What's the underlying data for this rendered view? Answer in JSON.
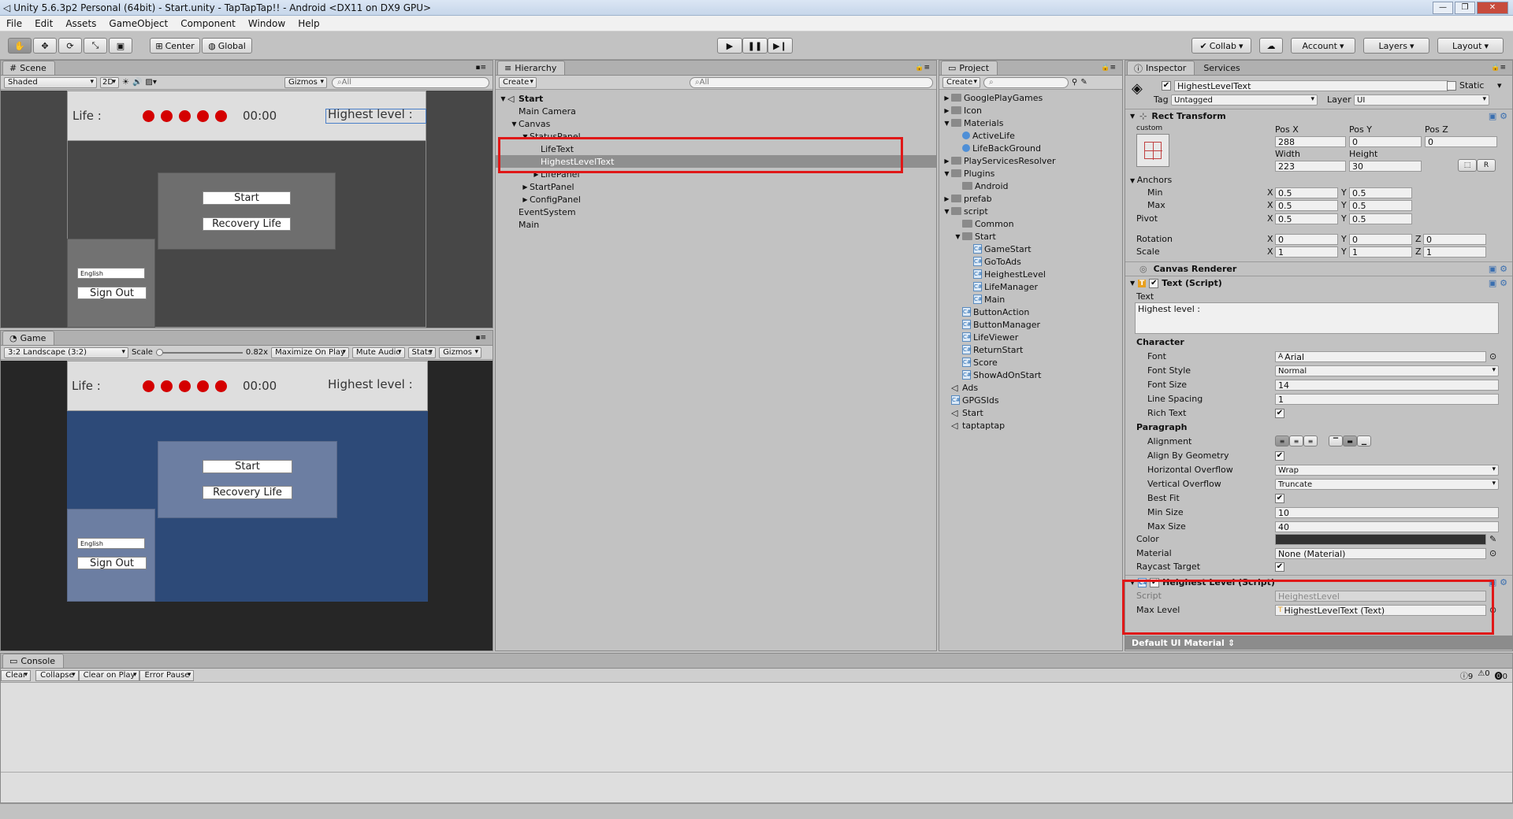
{
  "window": {
    "title": "Unity 5.6.3p2 Personal (64bit) - Start.unity - TapTapTap!! - Android <DX11 on DX9 GPU>"
  },
  "menu": [
    "File",
    "Edit",
    "Assets",
    "GameObject",
    "Component",
    "Window",
    "Help"
  ],
  "toolbar": {
    "center": "Center",
    "global": "Global",
    "collab": "Collab",
    "account": "Account",
    "layers": "Layers",
    "layout": "Layout"
  },
  "scene": {
    "tab": "Scene",
    "shaded": "Shaded",
    "mode2d": "2D",
    "gizmos": "Gizmos",
    "search": "All"
  },
  "game": {
    "tab": "Game",
    "aspect": "3:2 Landscape (3:2)",
    "scale_label": "Scale",
    "scale_value": "0.82x",
    "maximize": "Maximize On Play",
    "mute": "Mute Audio",
    "stats": "Stats",
    "gizmos": "Gizmos"
  },
  "ui": {
    "life": "Life :",
    "time": "00:00",
    "highest": "Highest level :",
    "start": "Start",
    "recovery": "Recovery Life",
    "language": "English",
    "signout": "Sign Out"
  },
  "hierarchy": {
    "tab": "Hierarchy",
    "create": "Create",
    "search": "All",
    "rows": [
      {
        "label": "Start",
        "indent": 0,
        "arrow": "▼",
        "bold": true
      },
      {
        "label": "Main Camera",
        "indent": 1,
        "arrow": ""
      },
      {
        "label": "Canvas",
        "indent": 1,
        "arrow": "▼"
      },
      {
        "label": "StatusPanel",
        "indent": 2,
        "arrow": "▼"
      },
      {
        "label": "LifeText",
        "indent": 3,
        "arrow": ""
      },
      {
        "label": "HighestLevelText",
        "indent": 3,
        "arrow": "",
        "selected": true
      },
      {
        "label": "LifePanel",
        "indent": 3,
        "arrow": "▶"
      },
      {
        "label": "StartPanel",
        "indent": 2,
        "arrow": "▶"
      },
      {
        "label": "ConfigPanel",
        "indent": 2,
        "arrow": "▶"
      },
      {
        "label": "EventSystem",
        "indent": 1,
        "arrow": ""
      },
      {
        "label": "Main",
        "indent": 1,
        "arrow": ""
      }
    ]
  },
  "project": {
    "tab": "Project",
    "create": "Create",
    "rows": [
      {
        "label": "GooglePlayGames",
        "indent": 0,
        "arrow": "▶",
        "icon": "folder"
      },
      {
        "label": "Icon",
        "indent": 0,
        "arrow": "▶",
        "icon": "folder"
      },
      {
        "label": "Materials",
        "indent": 0,
        "arrow": "▼",
        "icon": "folder"
      },
      {
        "label": "ActiveLife",
        "indent": 1,
        "arrow": "",
        "icon": "circle"
      },
      {
        "label": "LifeBackGround",
        "indent": 1,
        "arrow": "",
        "icon": "circle"
      },
      {
        "label": "PlayServicesResolver",
        "indent": 0,
        "arrow": "▶",
        "icon": "folder"
      },
      {
        "label": "Plugins",
        "indent": 0,
        "arrow": "▼",
        "icon": "folder"
      },
      {
        "label": "Android",
        "indent": 1,
        "arrow": "",
        "icon": "folder"
      },
      {
        "label": "prefab",
        "indent": 0,
        "arrow": "▶",
        "icon": "folder"
      },
      {
        "label": "script",
        "indent": 0,
        "arrow": "▼",
        "icon": "folder"
      },
      {
        "label": "Common",
        "indent": 1,
        "arrow": "",
        "icon": "folder"
      },
      {
        "label": "Start",
        "indent": 1,
        "arrow": "▼",
        "icon": "folder"
      },
      {
        "label": "GameStart",
        "indent": 2,
        "arrow": "",
        "icon": "script"
      },
      {
        "label": "GoToAds",
        "indent": 2,
        "arrow": "",
        "icon": "script"
      },
      {
        "label": "HeighestLevel",
        "indent": 2,
        "arrow": "",
        "icon": "script"
      },
      {
        "label": "LifeManager",
        "indent": 2,
        "arrow": "",
        "icon": "script"
      },
      {
        "label": "Main",
        "indent": 2,
        "arrow": "",
        "icon": "script"
      },
      {
        "label": "ButtonAction",
        "indent": 1,
        "arrow": "",
        "icon": "script"
      },
      {
        "label": "ButtonManager",
        "indent": 1,
        "arrow": "",
        "icon": "script"
      },
      {
        "label": "LifeViewer",
        "indent": 1,
        "arrow": "",
        "icon": "script"
      },
      {
        "label": "ReturnStart",
        "indent": 1,
        "arrow": "",
        "icon": "script"
      },
      {
        "label": "Score",
        "indent": 1,
        "arrow": "",
        "icon": "script"
      },
      {
        "label": "ShowAdOnStart",
        "indent": 1,
        "arrow": "",
        "icon": "script"
      },
      {
        "label": "Ads",
        "indent": 0,
        "arrow": "",
        "icon": "unity"
      },
      {
        "label": "GPGSIds",
        "indent": 0,
        "arrow": "",
        "icon": "script"
      },
      {
        "label": "Start",
        "indent": 0,
        "arrow": "",
        "icon": "unity"
      },
      {
        "label": "taptaptap",
        "indent": 0,
        "arrow": "",
        "icon": "unity"
      }
    ]
  },
  "inspector": {
    "tab": "Inspector",
    "services": "Services",
    "object_name": "HighestLevelText",
    "static": "Static",
    "tag_label": "Tag",
    "tag": "Untagged",
    "layer_label": "Layer",
    "layer": "UI",
    "rect": {
      "title": "Rect Transform",
      "custom": "custom",
      "posx_l": "Pos X",
      "posy_l": "Pos Y",
      "posz_l": "Pos Z",
      "posx": "288",
      "posy": "0",
      "posz": "0",
      "width_l": "Width",
      "height_l": "Height",
      "width": "223",
      "height": "30",
      "r": "R",
      "anchors": "Anchors",
      "min": "Min",
      "max": "Max",
      "pivot": "Pivot",
      "rotation": "Rotation",
      "scale": "Scale",
      "x": "X",
      "y": "Y",
      "z": "Z",
      "min_x": "0.5",
      "min_y": "0.5",
      "max_x": "0.5",
      "max_y": "0.5",
      "pivot_x": "0.5",
      "pivot_y": "0.5",
      "rot_x": "0",
      "rot_y": "0",
      "rot_z": "0",
      "scale_x": "1",
      "scale_y": "1",
      "scale_z": "1"
    },
    "canvas_renderer": "Canvas Renderer",
    "text": {
      "title": "Text (Script)",
      "text_label": "Text",
      "text_value": "Highest level :",
      "character": "Character",
      "font_l": "Font",
      "font": "Arial",
      "style_l": "Font Style",
      "style": "Normal",
      "size_l": "Font Size",
      "size": "14",
      "spacing_l": "Line Spacing",
      "spacing": "1",
      "rich_l": "Rich Text",
      "paragraph": "Paragraph",
      "align_l": "Alignment",
      "geom_l": "Align By Geometry",
      "hover_l": "Horizontal Overflow",
      "hover": "Wrap",
      "vover_l": "Vertical Overflow",
      "vover": "Truncate",
      "best_l": "Best Fit",
      "minsize_l": "Min Size",
      "minsize": "10",
      "maxsize_l": "Max Size",
      "maxsize": "40",
      "color_l": "Color",
      "material_l": "Material",
      "material": "None (Material)",
      "raycast_l": "Raycast Target"
    },
    "hl": {
      "title": "Heighest Level (Script)",
      "script_l": "Script",
      "script": "HeighestLevel",
      "max_l": "Max Level",
      "max": "HighestLevelText (Text)"
    },
    "default_mat": "Default UI Material"
  },
  "console": {
    "tab": "Console",
    "clear": "Clear",
    "collapse": "Collapse",
    "clear_on_play": "Clear on Play",
    "error_pause": "Error Pause",
    "info": "9",
    "warn": "0",
    "err": "0"
  },
  "colors": {
    "selection_red": "#e01818",
    "life_dot": "#d40000",
    "game_bg": "#2d4a78"
  }
}
